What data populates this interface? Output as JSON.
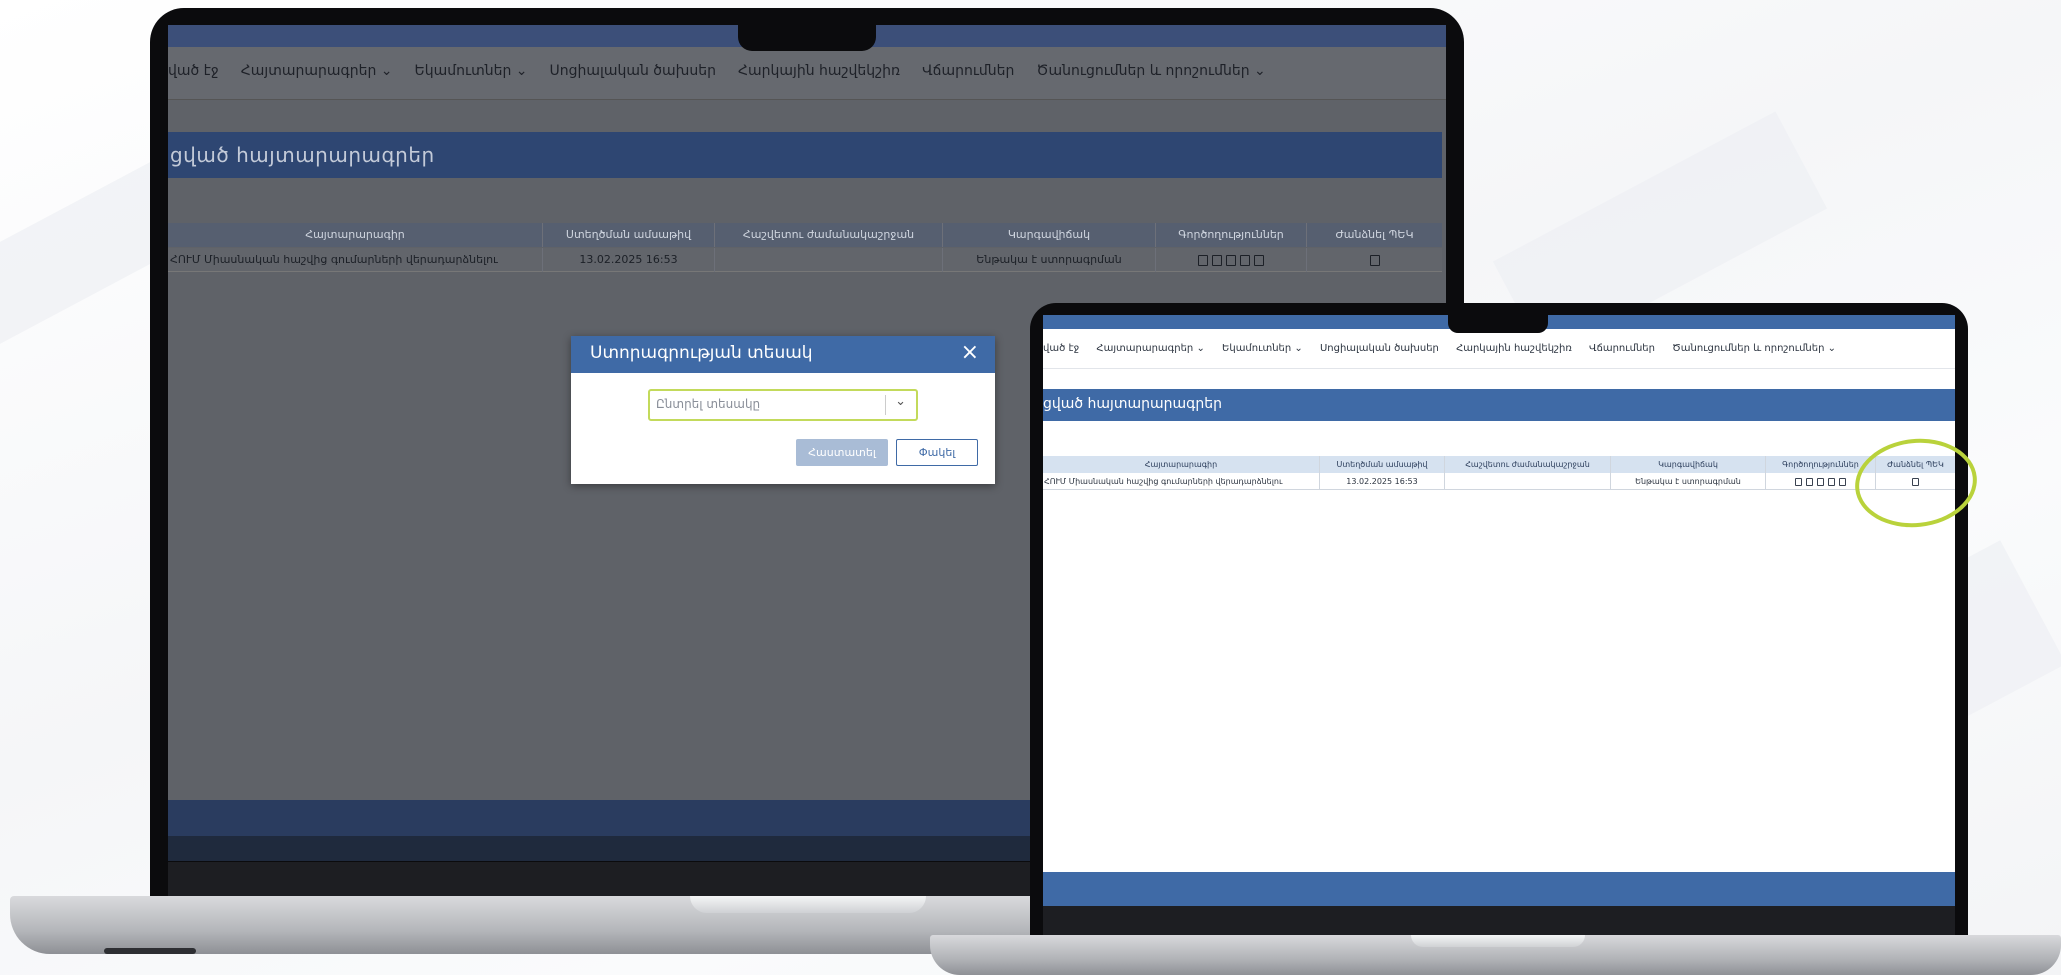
{
  "menu": {
    "items": [
      "ված էջ",
      "Հայտարարագրեր",
      "Եկամուտներ",
      "Սոցիալական ծախսեր",
      "Հարկային հաշվեկշիռ",
      "Վճարումներ",
      "Ծանուցումներ և որոշումներ"
    ]
  },
  "page": {
    "title": "ցված հայտարարագրեր"
  },
  "table": {
    "headers": [
      "Հայտարարագիր",
      "Ստեղծման ամսաթիվ",
      "Հաշվետու ժամանակաշրջան",
      "Կարգավիճակ",
      "Գործողություններ",
      "Ժանձնել ՊԵԿ"
    ],
    "row": {
      "declaration": "ՀՈՒՄ Միասնական հաշվից գումարների վերադարձնելու",
      "created": "13.02.2025 16:53",
      "period": "",
      "status": "Ենթակա է ստորագրման"
    }
  },
  "modal": {
    "title": "Ստորագրության տեսակ",
    "close": "×",
    "select_placeholder": "Ընտրել տեսակը",
    "confirm": "Հաստատել",
    "cancel": "Փակել"
  },
  "colors": {
    "accent": "#3f6aa6",
    "highlight": "#b9d23b"
  }
}
